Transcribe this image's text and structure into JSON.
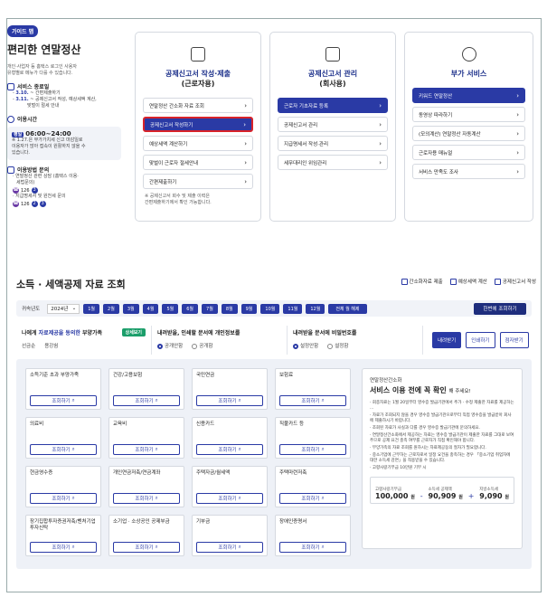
{
  "guide": {
    "badge": "가이드 맵",
    "title": "편리한 연말정산",
    "desc1": "개인·사업자 등 홈택스 로그인 사용자",
    "desc2": "유형별로 메뉴가 다를 수 있습니다.",
    "sched_title": "서비스 종료일",
    "sched1_date": "3.10.",
    "sched1_text": " ~ 간편제출하기",
    "sched2_date": "3.11.",
    "sched2_text": " ~ 공제신고서 작성, 예상세액 계산,",
    "sched2_text2": "맞벌이 절세 안내",
    "time_title": "이용시간",
    "time_tag": "평일",
    "time_value": "06:00~24:00",
    "time_note1": "※ 1.27.은 부가가치세 신고 마감일로",
    "time_note2": "이용자가 많아 접속이 원활하지 않을 수",
    "time_note3": "있습니다.",
    "ask_title": "이용방법 문의",
    "ask1": "· 연말정산 관련 상담 (홈택스 이용·",
    "ask1b": "세법문의)",
    "ask1_num": "126",
    "ask2": "· 지급명세서 및 원천세 문의",
    "ask2_num": "126"
  },
  "cards": [
    {
      "title": "공제신고서 작성·제출",
      "sub": "(근로자용)",
      "items": [
        "연말정산 간소화 자료 조회",
        "공제신고서 작성하기",
        "예상세액 계산하기",
        "맞벌이 근로자 절세안내",
        "간편제출하기"
      ],
      "note1": "※ 공제신고서 회수 및 제출 이력은",
      "note2": "간편제출하기에서 확인 가능합니다."
    },
    {
      "title": "공제신고서 관리",
      "sub": "(회사용)",
      "items": [
        "근로자 기초자료 등록",
        "공제신고서 관리",
        "지급명세서 작성·관리",
        "세무대리인 위임관리"
      ]
    },
    {
      "title": "부가 서비스",
      "sub": "",
      "items": [
        "키워드 연말정산",
        "동영상 따라하기",
        "(모의계산) 연말정산 자동계산",
        "근로자용 매뉴얼",
        "서비스 만족도 조사"
      ]
    }
  ],
  "search": {
    "title": "소득 · 세액공제 자료 조회",
    "link1": "간소화자료 제출",
    "link2": "예상세액 계산",
    "link3": "공제신고서 작성",
    "year_label": "귀속년도",
    "year_value": "2024년",
    "months": [
      "1월",
      "2월",
      "3월",
      "4월",
      "5월",
      "6월",
      "7월",
      "8월",
      "9월",
      "10월",
      "11월",
      "12월",
      "전체 월 해제"
    ],
    "all_btn": "한번에 조회하기"
  },
  "options": {
    "o1_title_a": "나에게 ",
    "o1_title_b": "자료제공을 동의한",
    "o1_title_c": " 부양가족",
    "o1_btn": "상세보기",
    "o1_v1": "선금순",
    "o1_v2": "용강쉼",
    "o2_title": "내려받을, 인쇄할 문서에 개인정보를",
    "o2_r1": "공개안함",
    "o2_r2": "공개함",
    "o3_title": "내려받을 문서에 비밀번호를",
    "o3_r1": "설정안함",
    "o3_r2": "설정함",
    "b1": "내려받기",
    "b2": "인쇄하기",
    "b3": "점자받기"
  },
  "tiles": [
    {
      "name": "소득기준 초과 부양가족",
      "btn": "조회하기"
    },
    {
      "name": "건강/고용보험",
      "btn": "조회하기"
    },
    {
      "name": "국민연금",
      "btn": "조회하기"
    },
    {
      "name": "보험료",
      "btn": "조회하기"
    },
    {
      "name": "의료비",
      "btn": "조회하기"
    },
    {
      "name": "교육비",
      "btn": "조회하기"
    },
    {
      "name": "신용카드",
      "btn": "조회하기"
    },
    {
      "name": "직불카드 등",
      "btn": "조회하기"
    },
    {
      "name": "현금영수증",
      "btn": "조회하기"
    },
    {
      "name": "개인연금저축/연금계좌",
      "btn": "조회하기"
    },
    {
      "name": "주택자금/월세액",
      "btn": "조회하기"
    },
    {
      "name": "주택마련저축",
      "btn": "조회하기"
    },
    {
      "name": "장기집합투자증권저축/벤처기업투자신탁",
      "btn": "조회하기"
    },
    {
      "name": "소기업 · 소상공인 공제부금",
      "btn": "조회하기"
    },
    {
      "name": "기부금",
      "btn": "조회하기"
    },
    {
      "name": "장애인증명서",
      "btn": "조회하기"
    }
  ],
  "notice": {
    "pre": "연말정산간소화",
    "title": "서비스 이용 전에 꼭 확인",
    "title_sub": "해 주세요!",
    "lines": [
      "· 회종자료는 1월 20일부터 영수증 발급기관에서 추가 · 수정 제출한 자료를 제공하는 ...",
      "· 자료가 조회되지 않을 경우 영수증 발급기관으로부터 직접 영수증을 발급받아 회사에 제출하시기 바랍니다.",
      "· 조회된 자료가 사실과 다를 경우 영수증 발급기관에 문의하세요.",
      "· 연말정산간소화에서 제공하는 자료는 영수증 발급기관이 제출한 자료를 그대로 보여주므로 공제 요건 충족 여부를 근로자가 직접 확인해야 합니다.",
      "· 부양가족의 자료 조회를 원하시는 자료제공동의 절차가 필요합니다.",
      "· 중소기업에 근무하는 근로자로서 일정 요건을 충족하는 경우 「중소기업 취업자에 대한 소득세 감면」을 적용받을 수 있습니다.",
      "· 고향사랑기부금 10만원 기부 시"
    ],
    "l1": "고향사랑기부금",
    "v1": "100,000",
    "l2": "소득세 공제액",
    "v2": "90,909",
    "l3": "지방소득세",
    "v3": "9,090",
    "unit": "원"
  }
}
